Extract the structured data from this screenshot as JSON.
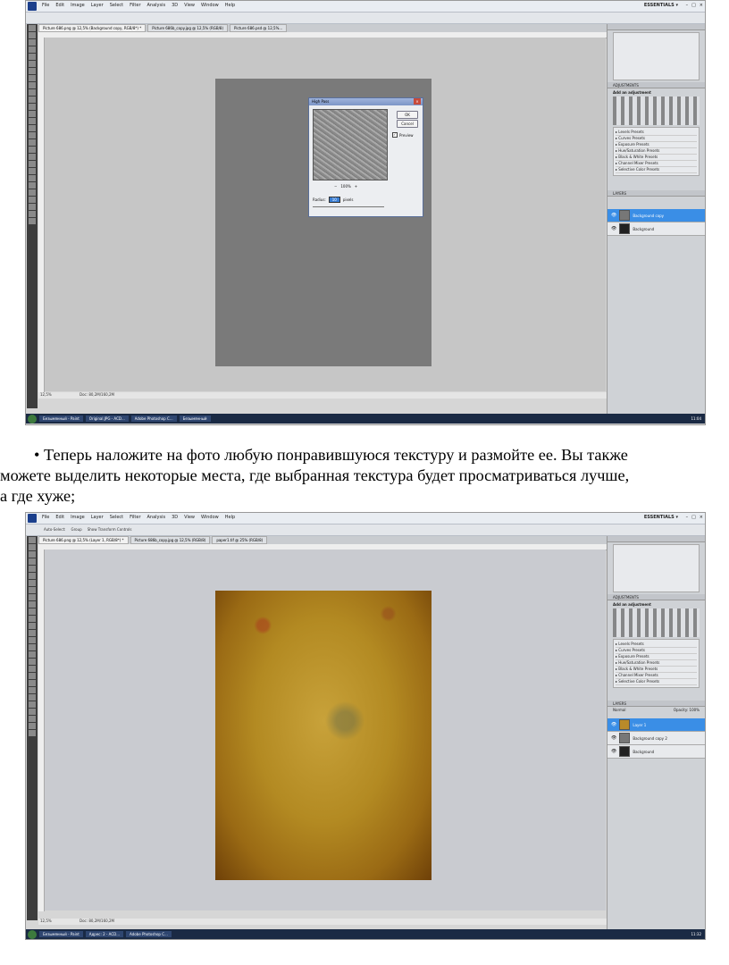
{
  "screenshot1": {
    "menu": [
      "File",
      "Edit",
      "Image",
      "Layer",
      "Select",
      "Filter",
      "Analysis",
      "3D",
      "View",
      "Window",
      "Help"
    ],
    "workspace": "ESSENTIALS ▾",
    "tabs": [
      "Picture 686.png @ 12,5% (Background copy, RGB/8*) *",
      "Picture 686b_copy.jpg @ 12,5% (RGB/8)",
      "Picture 686.psd @ 12,5%..."
    ],
    "zoom": "12,5%",
    "doc_size": "Doc: 80,2M/160,2M",
    "dialog": {
      "title": "High Pass",
      "ok": "OK",
      "cancel": "Cancel",
      "preview": "Preview",
      "zoom_level": "100%",
      "radius_label": "Radius:",
      "radius_value": "10",
      "unit": "pixels"
    },
    "adjustments_title": "ADJUSTMENTS",
    "adjustments_sub": "Add an adjustment",
    "presets": [
      "Levels Presets",
      "Curves Presets",
      "Exposure Presets",
      "Hue/Saturation Presets",
      "Black & White Presets",
      "Channel Mixer Presets",
      "Selective Color Presets"
    ],
    "layers_tab": "LAYERS",
    "layers": [
      "Background copy",
      "Background"
    ],
    "taskbar": [
      "Безымянный - Paint",
      "Original.JPG - ACD...",
      "Adobe Photoshop C...",
      "Безымянный"
    ],
    "clock": "11:04"
  },
  "caption": {
    "bullet": "•",
    "line1": "Теперь наложите на фото любую понравившуюся текстуру и размойте ее. Вы также",
    "line2": "можете выделить некоторые места, где выбранная текстура будет просматриваться лучше,",
    "line3": "а где хуже;"
  },
  "screenshot2": {
    "menu": [
      "File",
      "Edit",
      "Image",
      "Layer",
      "Select",
      "Filter",
      "Analysis",
      "3D",
      "View",
      "Window",
      "Help"
    ],
    "workspace": "ESSENTIALS ▾",
    "options": [
      "Auto-Select:",
      "Group",
      "Show Transform Controls"
    ],
    "tabs": [
      "Picture 686.png @ 12,5% (Layer 1, RGB/8*) *",
      "Picture 686b_copy.jpg @ 12,5% (RGB/8)",
      "paper1.tif @ 25% (RGB/8)"
    ],
    "zoom": "12,5%",
    "doc_size": "Doc: 80,2M/160,2M",
    "adjustments_title": "ADJUSTMENTS",
    "adjustments_sub": "Add an adjustment",
    "presets": [
      "Levels Presets",
      "Curves Presets",
      "Exposure Presets",
      "Hue/Saturation Presets",
      "Black & White Presets",
      "Channel Mixer Presets",
      "Selective Color Presets"
    ],
    "layers_tab": "LAYERS",
    "blend_mode": "Normal",
    "opacity": "Opacity: 100%",
    "layers": [
      "Layer 1",
      "Background copy 2",
      "Background"
    ],
    "taskbar": [
      "Безымянный - Paint",
      "Адрес: 2 - ACD...",
      "Adobe Photoshop C..."
    ],
    "clock": "11:32"
  }
}
